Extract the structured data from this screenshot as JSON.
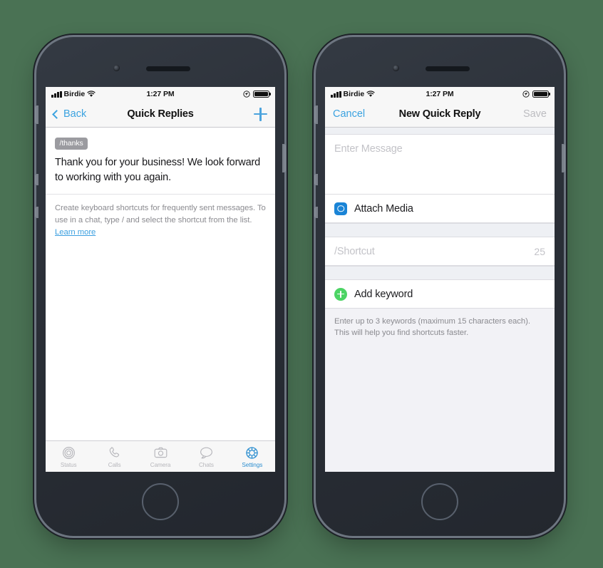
{
  "background_color": "#4a7254",
  "accent_blue": "#3aa2e0",
  "accent_green": "#4cd464",
  "status_bar": {
    "carrier": "Birdie",
    "time": "1:27 PM",
    "signal_icon": "signal-bars-icon",
    "wifi_icon": "wifi-icon",
    "location_icon": "location-arrow-icon",
    "battery_icon": "battery-full-icon"
  },
  "phone_left": {
    "nav": {
      "back_label": "Back",
      "back_icon": "chevron-left-icon",
      "title": "Quick Replies",
      "add_icon": "plus-icon"
    },
    "reply": {
      "shortcut": "/thanks",
      "message": "Thank you for your business! We look forward to working with you again."
    },
    "helper": {
      "text": "Create keyboard shortcuts for frequently sent messages. To use in a chat, type / and select the shortcut from the list. ",
      "link": "Learn more"
    },
    "tabs": [
      {
        "label": "Status",
        "icon": "status-rings-icon",
        "active": false
      },
      {
        "label": "Calls",
        "icon": "phone-handset-icon",
        "active": false
      },
      {
        "label": "Camera",
        "icon": "camera-icon",
        "active": false
      },
      {
        "label": "Chats",
        "icon": "chat-bubble-icon",
        "active": false
      },
      {
        "label": "Settings",
        "icon": "gear-icon",
        "active": true
      }
    ]
  },
  "phone_right": {
    "nav": {
      "cancel_label": "Cancel",
      "title": "New Quick Reply",
      "save_label": "Save"
    },
    "message_field": {
      "placeholder": "Enter Message",
      "value": ""
    },
    "attach_row": {
      "label": "Attach Media",
      "icon": "camera-icon"
    },
    "shortcut_field": {
      "placeholder": "/Shortcut",
      "value": "",
      "counter": "25"
    },
    "keyword_row": {
      "label": "Add keyword",
      "icon": "plus-circle-icon"
    },
    "footer_text": "Enter up to 3 keywords (maximum 15 characters each). This will help you find shortcuts faster."
  }
}
